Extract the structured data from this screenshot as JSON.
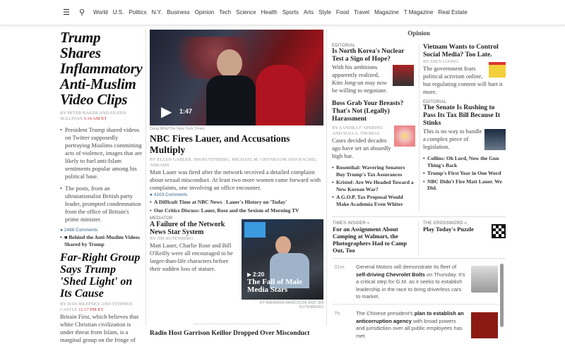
{
  "nav": {
    "items": [
      "World",
      "U.S.",
      "Politics",
      "N.Y.",
      "Business",
      "Opinion",
      "Tech",
      "Science",
      "Health",
      "Sports",
      "Arts",
      "Style",
      "Food",
      "Travel",
      "Magazine",
      "T Magazine",
      "Real Estate"
    ]
  },
  "left": {
    "headline": "Trump Shares Inflammatory Anti-Muslim Video Clips",
    "byline": "By PETER BAKER and EILEEN SULLIVAN",
    "time": "3:14 AM ET",
    "bullets": [
      "President Trump shared videos on Twitter supposedly portraying Muslims committing acts of violence, images that are likely to fuel anti-Islam sentiments popular among his political base.",
      "The posts, from an ultranationalist British party leader, prompted condemnation from the office of Britain's prime minister."
    ],
    "comments": "2498 Comments",
    "related": "Behind the Anti-Muslim Videos Shared by Trump",
    "headline2": "Far-Right Group Says Trump 'Shed Light' on Its Cause",
    "byline2": "By DAN BILEFSKY and STEPHEN CASTLE",
    "time2": "11:17 PM ET",
    "summary2": "Britain First, which believes that white Christian civilization is under threat from Islam, is a marginal group on the fringe of the far right. The..."
  },
  "center": {
    "video_duration": "1:47",
    "photo_credit": "Doug Mills/The New York Times",
    "headline": "NBC Fires Lauer, and Accusations Multiply",
    "byline": "By ELLEN GABLER, JIM RUTENBERG, MICHAEL M. GRYNBAUM and RACHEL ABRAMS",
    "summary": "Matt Lauer was fired after the network received a detailed complaint about sexual misconduct. At least two more women came forward with complaints, one involving an office encounter.",
    "comments": "4103 Comments",
    "related": [
      "A Difficult Time at NBC News",
      "Lauer's History on 'Today'",
      "Our Critics Discuss: Lauer, Rose and the Sexism of Morning TV"
    ],
    "kicker2": "MEDIATOR",
    "headline2": "A Failure of the Network News Star System",
    "byline2": "By JIM RUTENBERG",
    "summary2": "Matt Lauer, Charlie Rose and Bill O'Reilly were all encouraged to be larger-than-life characters before their sudden loss of stature.",
    "video2_duration": "2:20",
    "video2_title": "The Fall of Male Media Stars",
    "video2_credit": "By BARBARA MARCOLINI and JIM RUTENBERG",
    "headline3": "Radio Host Garrison Keillor Dropped Over Misconduct"
  },
  "opinion": {
    "title": "Opinion",
    "a1": {
      "kicker": "EDITORIAL",
      "headline": "Is North Korea's Nuclear Test a Sign of Hope?",
      "summary": "With his ambitions apparently realized, Kim Jong-un may now be willing to negotiate."
    },
    "a2": {
      "headline": "Boss Grab Your Breasts? That's Not (Legally) Harassment",
      "byline": "By SANDRA F. SPERINO and SUJA A. THOMAS",
      "summary": "Cases decided decades ago have set an absurdly high bar."
    },
    "links1": [
      "Rosenthal: Wavering Senators Buy Trump's Tax Assurances",
      "Kristof: Are We Headed Toward a New Korean War?",
      "A G.O.P. Tax Proposal Would Make Academia Even Whiter"
    ],
    "a3": {
      "headline": "Vietnam Wants to Control Social Media? Too Late.",
      "byline": "By DIEN LUONG",
      "summary": "The government fears political activism online, but regulating content will hurt it more."
    },
    "a4": {
      "kicker": "EDITORIAL",
      "headline": "The Senate Is Rushing to Pass Its Tax Bill Because It Stinks",
      "summary": "This is no way to handle a complex piece of legislation."
    },
    "links2": [
      "Collins: Oh Lord, Now the Gun Thing's Back",
      "Trump's First Year in One Word",
      "NBC Didn't Fire Matt Lauer. We Did."
    ]
  },
  "insider": {
    "kicker": "TIMES INSIDER »",
    "headline": "For an Assignment About Camping at Walmart, the Photographers Had to Camp Out, Too"
  },
  "crossword": {
    "kicker": "THE CROSSWORD »",
    "headline": "Play Today's Puzzle"
  },
  "feed": [
    {
      "time": "31m",
      "pre": "General Motors will demonstrate its fleet of ",
      "bold": "self-driving Chevrolet Bolts",
      "post": " on Thursday. It's a critical step for G.M. as it seeks to establish leadership in the race to bring driverless cars to market."
    },
    {
      "time": "7h",
      "pre": "The Chinese president's ",
      "bold": "plan to establish an anticorruption agency",
      "post": " with broad powers and jurisdiction over all public employees has met"
    }
  ]
}
